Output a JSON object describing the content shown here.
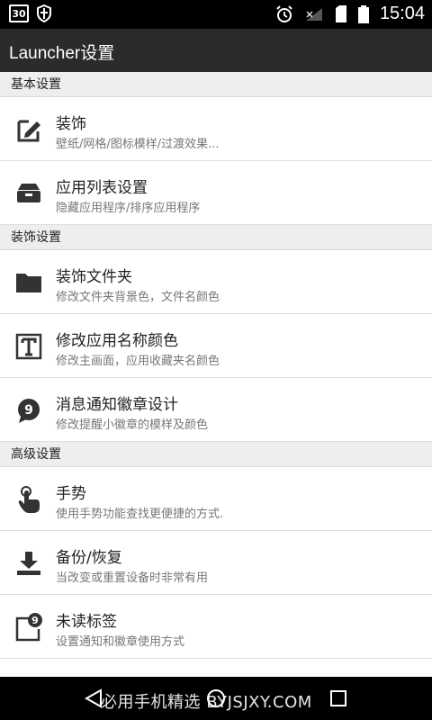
{
  "status_bar": {
    "calendar_day": "30",
    "time": "15:04",
    "icons": [
      "calendar-icon",
      "shield-icon",
      "alarm-icon",
      "signal-icon",
      "sim-icon",
      "battery-icon"
    ]
  },
  "app_bar": {
    "title": "Launcher设置"
  },
  "sections": [
    {
      "header": "基本设置",
      "items": [
        {
          "icon": "pen-edit-icon",
          "title": "装饰",
          "subtitle": "壁纸/网格/图标模样/过渡效果..."
        },
        {
          "icon": "inbox-tray-icon",
          "title": "应用列表设置",
          "subtitle": "隐藏应用程序/排序应用程序"
        }
      ]
    },
    {
      "header": "装饰设置",
      "items": [
        {
          "icon": "folder-icon",
          "title": "装饰文件夹",
          "subtitle": "修改文件夹背景色，文件名颜色"
        },
        {
          "icon": "text-format-icon",
          "title": "修改应用名称颜色",
          "subtitle": "修改主画面，应用收藏夹名颜色"
        },
        {
          "icon": "notification-badge-icon",
          "badge": "9",
          "title": "消息通知徽章设计",
          "subtitle": "修改提醒小徽章的模样及颜色"
        }
      ]
    },
    {
      "header": "高级设置",
      "items": [
        {
          "icon": "gesture-hand-icon",
          "title": "手势",
          "subtitle": "使用手势功能查找更便捷的方式."
        },
        {
          "icon": "download-backup-icon",
          "title": "备份/恢复",
          "subtitle": "当改变或重置设备时非常有用"
        },
        {
          "icon": "unread-badge-icon",
          "badge": "9",
          "title": "未读标签",
          "subtitle": "设置通知和徽章使用方式"
        }
      ]
    }
  ],
  "nav_bar": {
    "watermark": "必用手机精选 BYJSJXY.COM",
    "buttons": [
      "back-icon",
      "home-icon",
      "recents-icon"
    ]
  }
}
